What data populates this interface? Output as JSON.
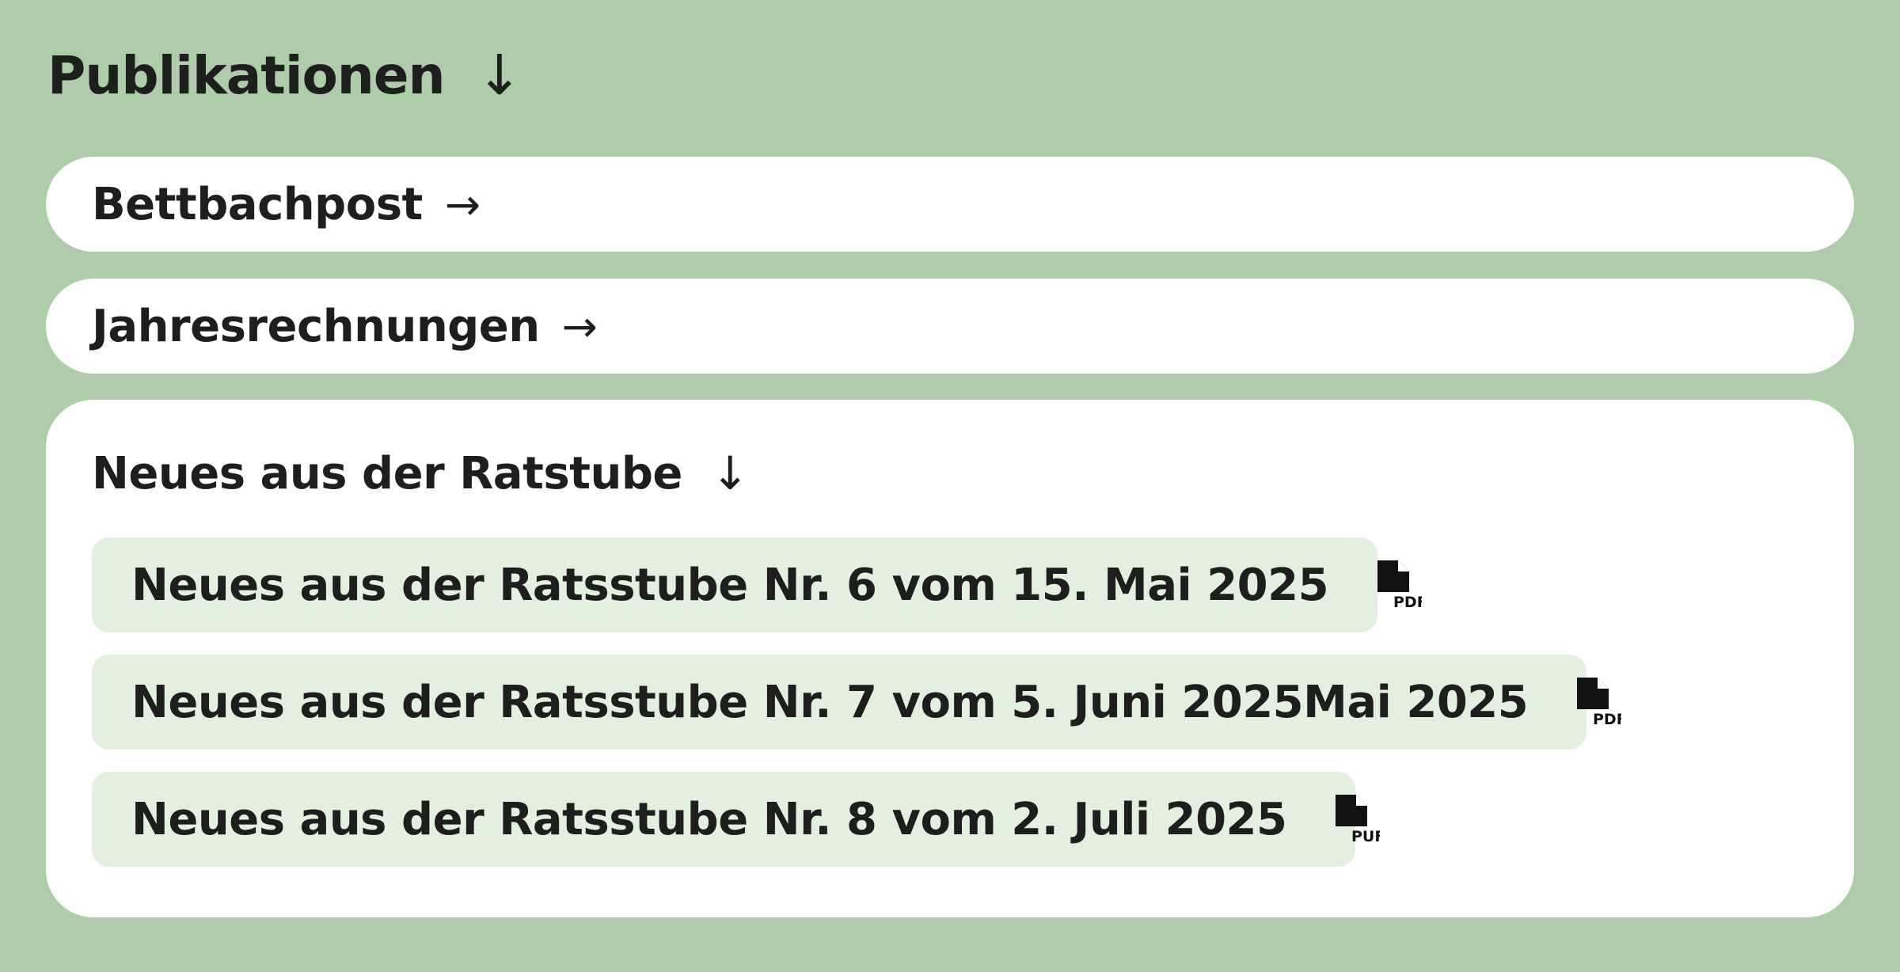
{
  "heading": {
    "title": "Publikationen",
    "arrow": "↓"
  },
  "links": [
    {
      "label": "Bettbachpost",
      "arrow": "→"
    },
    {
      "label": "Jahresrechnungen",
      "arrow": "→"
    }
  ],
  "ratstube": {
    "title": "Neues aus der Ratstube",
    "arrow": "↓",
    "items": [
      {
        "label": "Neues aus der Ratsstube Nr. 6 vom 15. Mai 2025",
        "icon": "pdf-file-icon",
        "icon_text": "PDF"
      },
      {
        "label": "Neues aus der Ratsstube Nr. 7 vom 5. Juni 2025Mai 2025",
        "icon": "pdf-file-icon",
        "icon_text": "PDF"
      },
      {
        "label": "Neues aus der Ratsstube Nr. 8 vom 2. Juli 2025",
        "icon": "pdf-file-icon",
        "icon_text": "PUF"
      }
    ]
  },
  "colors": {
    "background": "#aecca9",
    "card": "#ffffff",
    "item": "#e3f0df",
    "text": "#1c1f1c"
  }
}
